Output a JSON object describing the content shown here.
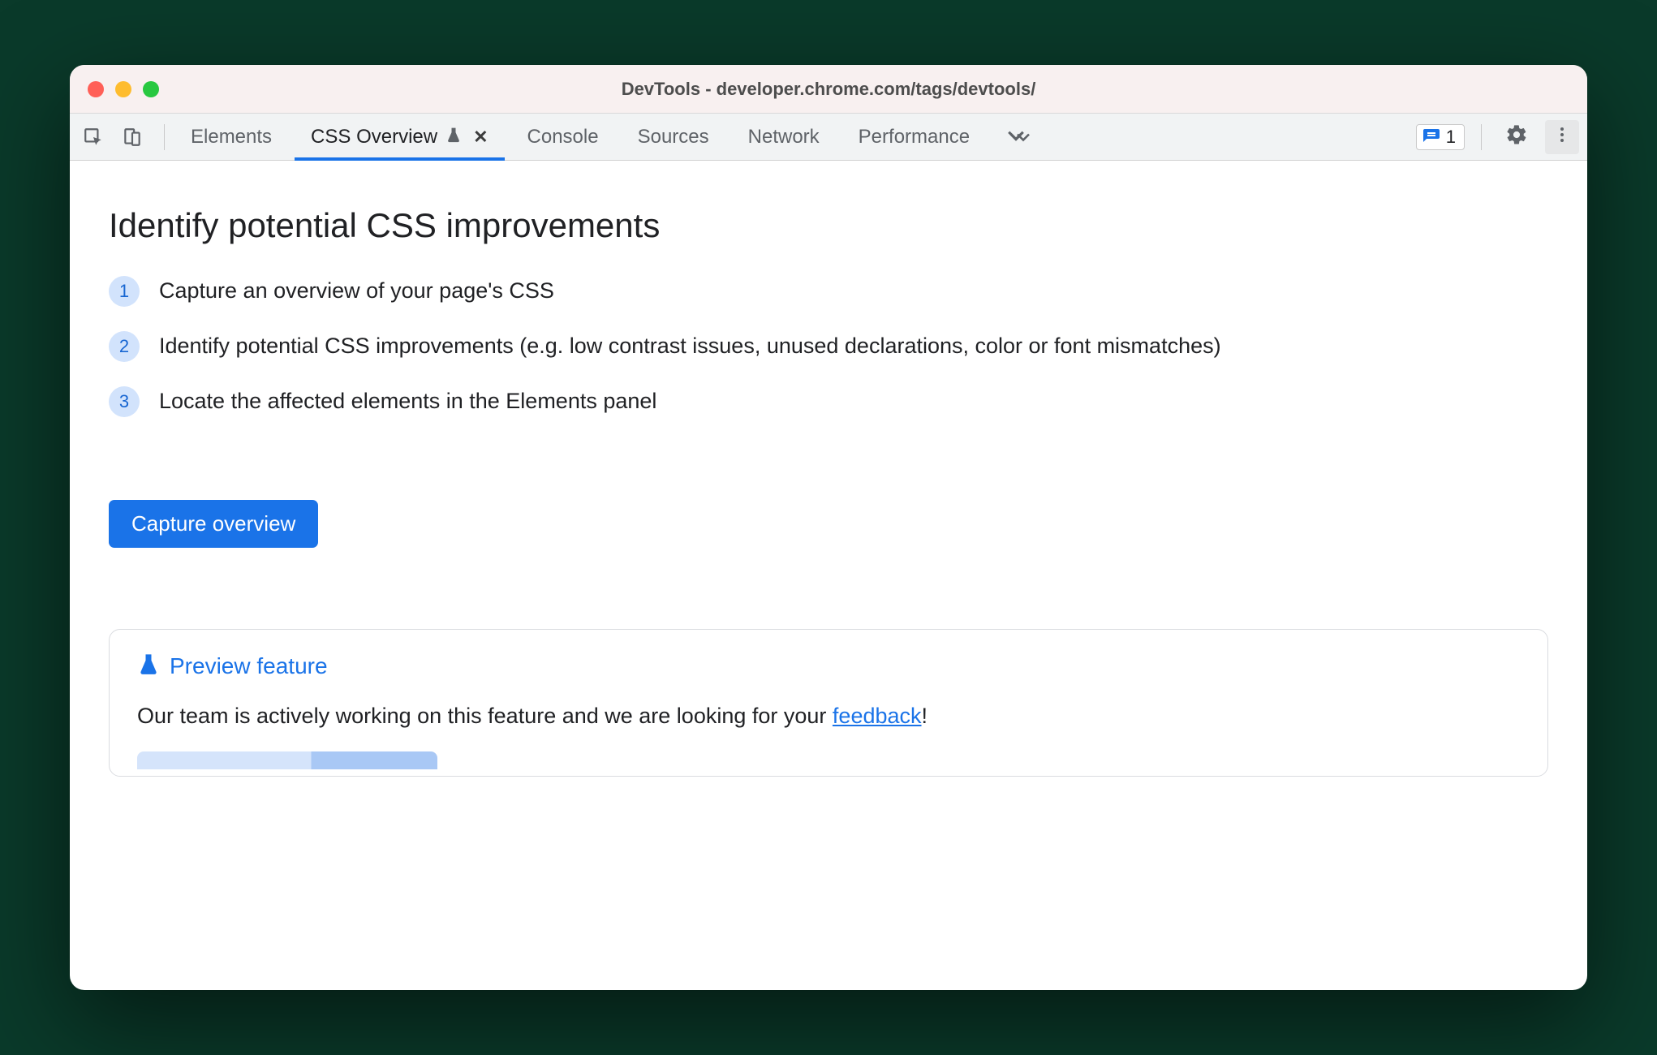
{
  "window": {
    "title": "DevTools - developer.chrome.com/tags/devtools/"
  },
  "toolbar": {
    "tabs": [
      {
        "label": "Elements",
        "active": false
      },
      {
        "label": "CSS Overview",
        "active": true,
        "experiment": true,
        "closable": true
      },
      {
        "label": "Console",
        "active": false
      },
      {
        "label": "Sources",
        "active": false
      },
      {
        "label": "Network",
        "active": false
      },
      {
        "label": "Performance",
        "active": false
      }
    ],
    "issues_count": "1"
  },
  "main": {
    "title": "Identify potential CSS improvements",
    "steps": [
      {
        "num": "1",
        "text": "Capture an overview of your page's CSS"
      },
      {
        "num": "2",
        "text": "Identify potential CSS improvements (e.g. low contrast issues, unused declarations, color or font mismatches)"
      },
      {
        "num": "3",
        "text": "Locate the affected elements in the Elements panel"
      }
    ],
    "capture_button": "Capture overview"
  },
  "preview": {
    "header": "Preview feature",
    "body_prefix": "Our team is actively working on this feature and we are looking for your ",
    "link_text": "feedback",
    "body_suffix": "!"
  }
}
